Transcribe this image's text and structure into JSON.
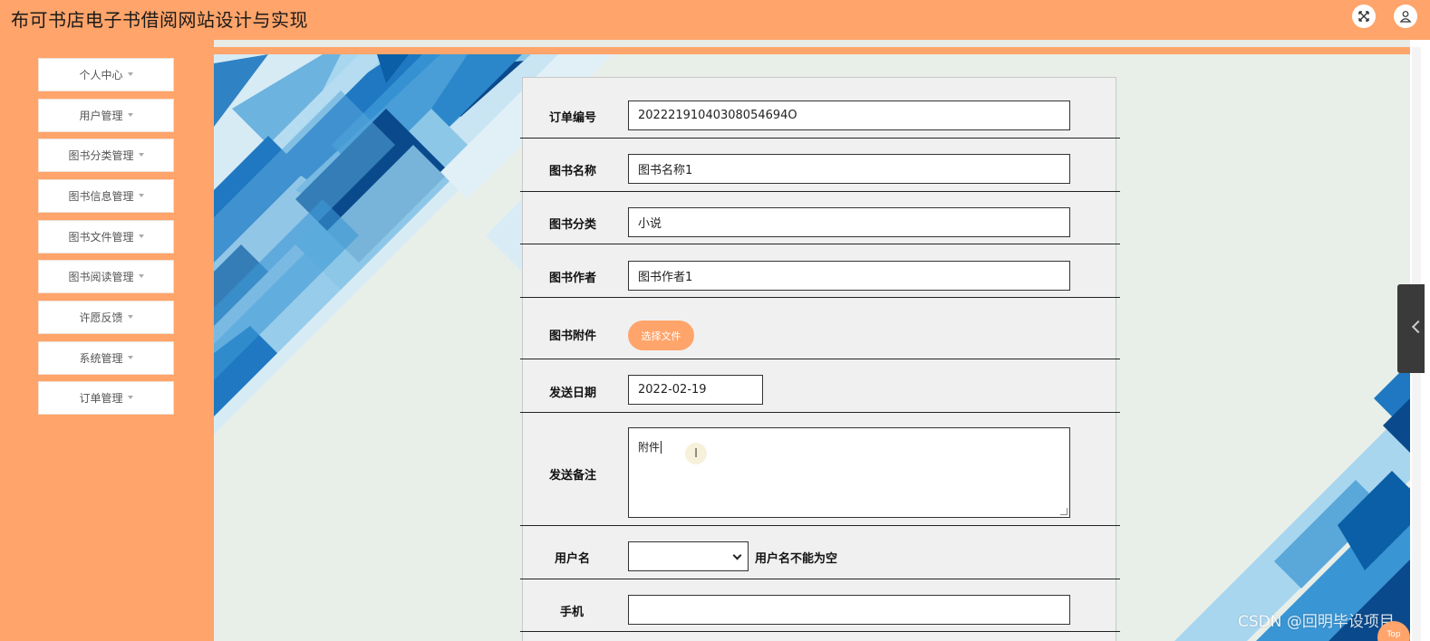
{
  "header": {
    "title": "布可书店电子书借阅网站设计与实现",
    "icons": {
      "fullscreen": "fullscreen-icon",
      "user": "user-icon"
    }
  },
  "sidebar": {
    "items": [
      {
        "label": "个人中心"
      },
      {
        "label": "用户管理"
      },
      {
        "label": "图书分类管理"
      },
      {
        "label": "图书信息管理"
      },
      {
        "label": "图书文件管理"
      },
      {
        "label": "图书阅读管理"
      },
      {
        "label": "许愿反馈"
      },
      {
        "label": "系统管理"
      },
      {
        "label": "订单管理"
      }
    ]
  },
  "form": {
    "order_no": {
      "label": "订单编号",
      "value": "20222191040308054694O"
    },
    "book_name": {
      "label": "图书名称",
      "value": "图书名称1"
    },
    "book_category": {
      "label": "图书分类",
      "value": "小说"
    },
    "book_author": {
      "label": "图书作者",
      "value": "图书作者1"
    },
    "book_attachment": {
      "label": "图书附件",
      "button_label": "选择文件"
    },
    "send_date": {
      "label": "发送日期",
      "value": "2022-02-19"
    },
    "send_note": {
      "label": "发送备注",
      "value": "附件"
    },
    "username": {
      "label": "用户名",
      "value": "",
      "error": "用户名不能为空"
    },
    "phone": {
      "label": "手机",
      "value": ""
    }
  },
  "floating": {
    "top_button": "Top"
  },
  "watermark": "CSDN @回明毕设项目",
  "colors": {
    "accent": "#ffa46a",
    "panel": "#f0f0f1",
    "dark_blue": "#0a4a8c",
    "mid_blue": "#1f78c1",
    "light_blue": "#8cc7e8"
  }
}
